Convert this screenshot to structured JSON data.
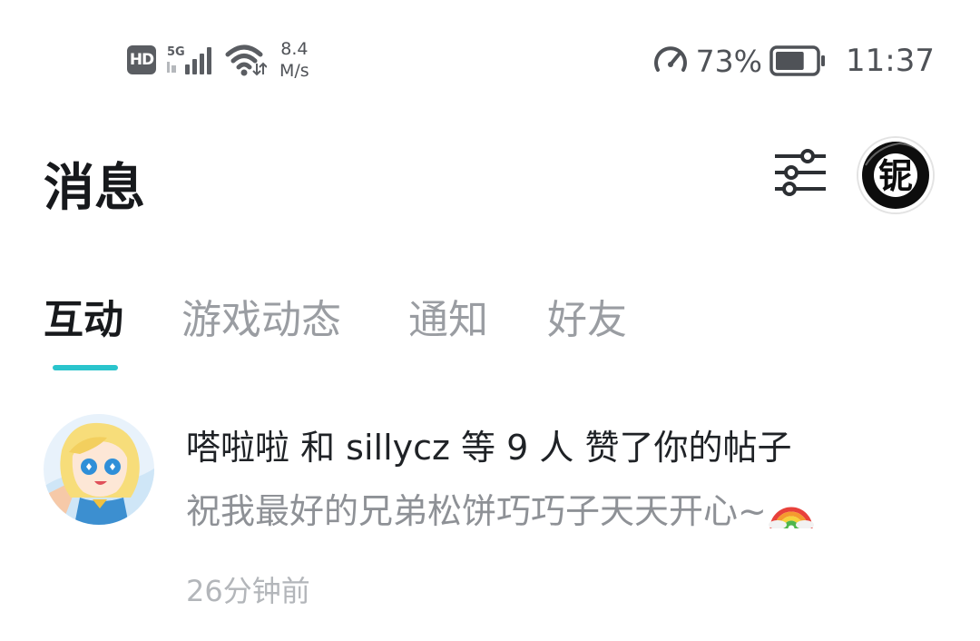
{
  "status_bar": {
    "hd_badge": "HD",
    "network_type": "5G",
    "net_speed_value": "8.4",
    "net_speed_unit": "M/s",
    "battery_percent": "73%",
    "battery_level": 0.73,
    "time": "11:37"
  },
  "header": {
    "title": "消息"
  },
  "tabs": [
    {
      "label": "互动",
      "active": true
    },
    {
      "label": "游戏动态",
      "active": false
    },
    {
      "label": "通知",
      "active": false
    },
    {
      "label": "好友",
      "active": false
    }
  ],
  "messages": [
    {
      "title": "嗒啦啦 和 sillycz 等 9 人 赞了你的帖子",
      "preview": "祝我最好的兄弟松饼巧巧子天天开心~",
      "time": "26分钟前"
    }
  ],
  "icons": {
    "filter": "filter-sliders-icon",
    "avatar_glyph": "铌",
    "rainbow": "rainbow-emoji"
  },
  "colors": {
    "accent": "#2ac4cc",
    "title": "#17191c",
    "muted": "#9a9da2"
  }
}
